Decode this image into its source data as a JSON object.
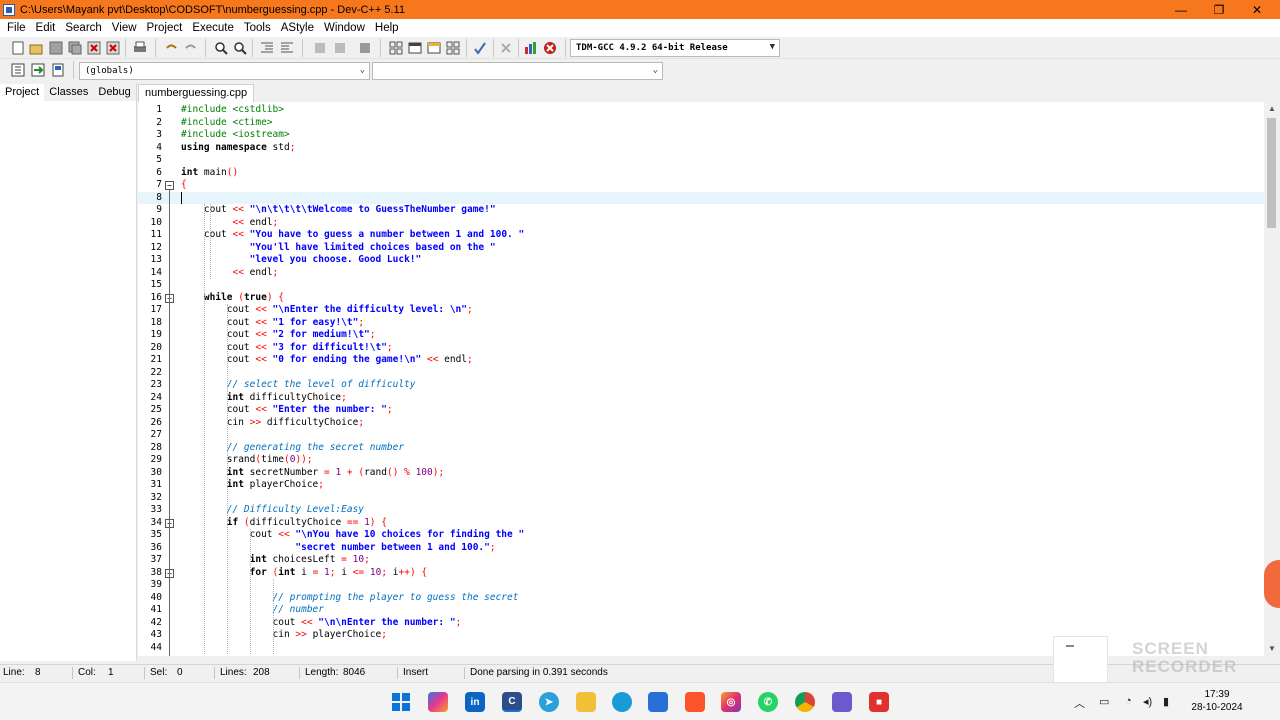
{
  "window": {
    "title": "C:\\Users\\Mayank pvt\\Desktop\\CODSOFT\\numberguessing.cpp - Dev-C++ 5.11",
    "controls": [
      "—",
      "❐",
      "✕"
    ]
  },
  "menu": [
    "File",
    "Edit",
    "Search",
    "View",
    "Project",
    "Execute",
    "Tools",
    "AStyle",
    "Window",
    "Help"
  ],
  "toolbar": {
    "compiler": "TDM-GCC 4.9.2 64-bit Release",
    "scope": "(globals)",
    "member": ""
  },
  "left_panel": {
    "tabs": [
      "Project",
      "Classes",
      "Debug"
    ],
    "active": "Project"
  },
  "editor": {
    "file_tab": "numberguessing.cpp",
    "current_line": 8,
    "lines": [
      [
        {
          "t": "#include <cstdlib>",
          "c": "pp"
        }
      ],
      [
        {
          "t": "#include <ctime>",
          "c": "pp"
        }
      ],
      [
        {
          "t": "#include <iostream>",
          "c": "pp"
        }
      ],
      [
        {
          "t": "using namespace ",
          "c": "kw"
        },
        {
          "t": "std",
          "c": ""
        },
        {
          "t": ";",
          "c": "sym"
        }
      ],
      [],
      [
        {
          "t": "int ",
          "c": "kw"
        },
        {
          "t": "main",
          "c": ""
        },
        {
          "t": "()",
          "c": "sym"
        }
      ],
      [
        {
          "t": "{",
          "c": "sym"
        }
      ],
      [],
      [
        {
          "t": "    cout ",
          "c": ""
        },
        {
          "t": "<< ",
          "c": "sym"
        },
        {
          "t": "\"\\n\\t\\t\\t\\tWelcome to GuessTheNumber game!\"",
          "c": "str"
        }
      ],
      [
        {
          "t": "         ",
          "c": ""
        },
        {
          "t": "<< ",
          "c": "sym"
        },
        {
          "t": "endl",
          "c": ""
        },
        {
          "t": ";",
          "c": "sym"
        }
      ],
      [
        {
          "t": "    cout ",
          "c": ""
        },
        {
          "t": "<< ",
          "c": "sym"
        },
        {
          "t": "\"You have to guess a number between 1 and 100. \"",
          "c": "str"
        }
      ],
      [
        {
          "t": "            ",
          "c": ""
        },
        {
          "t": "\"You'll have limited choices based on the \"",
          "c": "str"
        }
      ],
      [
        {
          "t": "            ",
          "c": ""
        },
        {
          "t": "\"level you choose. Good Luck!\"",
          "c": "str"
        }
      ],
      [
        {
          "t": "         ",
          "c": ""
        },
        {
          "t": "<< ",
          "c": "sym"
        },
        {
          "t": "endl",
          "c": ""
        },
        {
          "t": ";",
          "c": "sym"
        }
      ],
      [],
      [
        {
          "t": "    while ",
          "c": "kw"
        },
        {
          "t": "(",
          "c": "sym"
        },
        {
          "t": "true",
          "c": "kw"
        },
        {
          "t": ") {",
          "c": "sym"
        }
      ],
      [
        {
          "t": "        cout ",
          "c": ""
        },
        {
          "t": "<< ",
          "c": "sym"
        },
        {
          "t": "\"\\nEnter the difficulty level: \\n\"",
          "c": "str"
        },
        {
          "t": ";",
          "c": "sym"
        }
      ],
      [
        {
          "t": "        cout ",
          "c": ""
        },
        {
          "t": "<< ",
          "c": "sym"
        },
        {
          "t": "\"1 for easy!\\t\"",
          "c": "str"
        },
        {
          "t": ";",
          "c": "sym"
        }
      ],
      [
        {
          "t": "        cout ",
          "c": ""
        },
        {
          "t": "<< ",
          "c": "sym"
        },
        {
          "t": "\"2 for medium!\\t\"",
          "c": "str"
        },
        {
          "t": ";",
          "c": "sym"
        }
      ],
      [
        {
          "t": "        cout ",
          "c": ""
        },
        {
          "t": "<< ",
          "c": "sym"
        },
        {
          "t": "\"3 for difficult!\\t\"",
          "c": "str"
        },
        {
          "t": ";",
          "c": "sym"
        }
      ],
      [
        {
          "t": "        cout ",
          "c": ""
        },
        {
          "t": "<< ",
          "c": "sym"
        },
        {
          "t": "\"0 for ending the game!\\n\" ",
          "c": "str"
        },
        {
          "t": "<< ",
          "c": "sym"
        },
        {
          "t": "endl",
          "c": ""
        },
        {
          "t": ";",
          "c": "sym"
        }
      ],
      [],
      [
        {
          "t": "        // select the level of difficulty",
          "c": "cmt"
        }
      ],
      [
        {
          "t": "        int ",
          "c": "kw"
        },
        {
          "t": "difficultyChoice",
          "c": ""
        },
        {
          "t": ";",
          "c": "sym"
        }
      ],
      [
        {
          "t": "        cout ",
          "c": ""
        },
        {
          "t": "<< ",
          "c": "sym"
        },
        {
          "t": "\"Enter the number: \"",
          "c": "str"
        },
        {
          "t": ";",
          "c": "sym"
        }
      ],
      [
        {
          "t": "        cin ",
          "c": ""
        },
        {
          "t": ">> ",
          "c": "sym"
        },
        {
          "t": "difficultyChoice",
          "c": ""
        },
        {
          "t": ";",
          "c": "sym"
        }
      ],
      [],
      [
        {
          "t": "        // generating the secret number",
          "c": "cmt"
        }
      ],
      [
        {
          "t": "        srand",
          "c": ""
        },
        {
          "t": "(",
          "c": "sym"
        },
        {
          "t": "time",
          "c": ""
        },
        {
          "t": "(",
          "c": "sym"
        },
        {
          "t": "0",
          "c": "num"
        },
        {
          "t": "));",
          "c": "sym"
        }
      ],
      [
        {
          "t": "        int ",
          "c": "kw"
        },
        {
          "t": "secretNumber ",
          "c": ""
        },
        {
          "t": "= ",
          "c": "sym"
        },
        {
          "t": "1 ",
          "c": "num"
        },
        {
          "t": "+ (",
          "c": "sym"
        },
        {
          "t": "rand",
          "c": ""
        },
        {
          "t": "() % ",
          "c": "sym"
        },
        {
          "t": "100",
          "c": "num"
        },
        {
          "t": ");",
          "c": "sym"
        }
      ],
      [
        {
          "t": "        int ",
          "c": "kw"
        },
        {
          "t": "playerChoice",
          "c": ""
        },
        {
          "t": ";",
          "c": "sym"
        }
      ],
      [],
      [
        {
          "t": "        // Difficulty Level:Easy",
          "c": "cmt"
        }
      ],
      [
        {
          "t": "        if ",
          "c": "kw"
        },
        {
          "t": "(",
          "c": "sym"
        },
        {
          "t": "difficultyChoice ",
          "c": ""
        },
        {
          "t": "== ",
          "c": "sym"
        },
        {
          "t": "1",
          "c": "num"
        },
        {
          "t": ") {",
          "c": "sym"
        }
      ],
      [
        {
          "t": "            cout ",
          "c": ""
        },
        {
          "t": "<< ",
          "c": "sym"
        },
        {
          "t": "\"\\nYou have 10 choices for finding the \"",
          "c": "str"
        }
      ],
      [
        {
          "t": "                    ",
          "c": ""
        },
        {
          "t": "\"secret number between 1 and 100.\"",
          "c": "str"
        },
        {
          "t": ";",
          "c": "sym"
        }
      ],
      [
        {
          "t": "            int ",
          "c": "kw"
        },
        {
          "t": "choicesLeft ",
          "c": ""
        },
        {
          "t": "= ",
          "c": "sym"
        },
        {
          "t": "10",
          "c": "num"
        },
        {
          "t": ";",
          "c": "sym"
        }
      ],
      [
        {
          "t": "            for ",
          "c": "kw"
        },
        {
          "t": "(",
          "c": "sym"
        },
        {
          "t": "int ",
          "c": "kw"
        },
        {
          "t": "i ",
          "c": ""
        },
        {
          "t": "= ",
          "c": "sym"
        },
        {
          "t": "1",
          "c": "num"
        },
        {
          "t": "; ",
          "c": "sym"
        },
        {
          "t": "i ",
          "c": ""
        },
        {
          "t": "<= ",
          "c": "sym"
        },
        {
          "t": "10",
          "c": "num"
        },
        {
          "t": "; ",
          "c": "sym"
        },
        {
          "t": "i",
          "c": ""
        },
        {
          "t": "++) {",
          "c": "sym"
        }
      ],
      [],
      [
        {
          "t": "                // prompting the player to guess the secret",
          "c": "cmt"
        }
      ],
      [
        {
          "t": "                // number",
          "c": "cmt"
        }
      ],
      [
        {
          "t": "                cout ",
          "c": ""
        },
        {
          "t": "<< ",
          "c": "sym"
        },
        {
          "t": "\"\\n\\nEnter the number: \"",
          "c": "str"
        },
        {
          "t": ";",
          "c": "sym"
        }
      ],
      [
        {
          "t": "                cin ",
          "c": ""
        },
        {
          "t": ">> ",
          "c": "sym"
        },
        {
          "t": "playerChoice",
          "c": ""
        },
        {
          "t": ";",
          "c": "sym"
        }
      ],
      []
    ]
  },
  "status": {
    "line_label": "Line:",
    "line_val": "8",
    "col_label": "Col:",
    "col_val": "1",
    "sel_label": "Sel:",
    "sel_val": "0",
    "lines_label": "Lines:",
    "lines_val": "208",
    "length_label": "Length:",
    "length_val": "8046",
    "mode": "Insert",
    "message": "Done parsing in 0.391 seconds"
  },
  "watermark": [
    "SCREEN",
    "RECORDER"
  ],
  "taskbar": {
    "time": "17:39",
    "date": "28-10-2024"
  }
}
